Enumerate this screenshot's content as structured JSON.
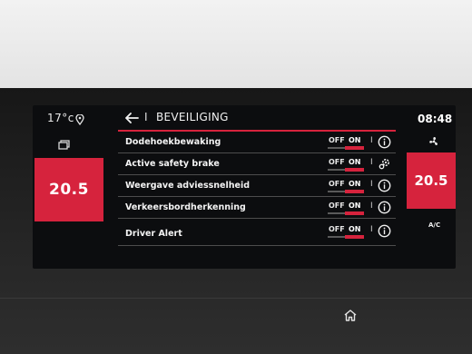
{
  "left_panel": {
    "outside_temp": "17°c",
    "location_icon": "location-pin-icon",
    "stack_icon": "screens-icon",
    "temp_setting": "20.5"
  },
  "right_panel": {
    "clock": "08:48",
    "fan_icon": "fan-icon",
    "temp_setting": "20.5",
    "ac_label": "A/C"
  },
  "header": {
    "back_icon": "arrow-left-icon",
    "separator": "I",
    "title": "BEVEILIGING"
  },
  "rows": [
    {
      "label": "Dodehoekbewaking",
      "off": "OFF",
      "on": "ON",
      "state": "ON",
      "action_icon": "info-icon"
    },
    {
      "label": "Active safety brake",
      "off": "OFF",
      "on": "ON",
      "state": "ON",
      "action_icon": "settings-icon"
    },
    {
      "label": "Weergave adviessnelheid",
      "off": "OFF",
      "on": "ON",
      "state": "ON",
      "action_icon": "info-icon"
    },
    {
      "label": "Verkeersbordherkenning",
      "off": "OFF",
      "on": "ON",
      "state": "ON",
      "action_icon": "info-icon"
    },
    {
      "label": "Driver Alert",
      "off": "OFF",
      "on": "ON",
      "state": "ON",
      "action_icon": "info-icon"
    }
  ],
  "row_separator": "I",
  "colors": {
    "accent": "#d6233d",
    "screen_bg": "#0c0d0f",
    "text": "#f4f4f4"
  },
  "home_icon": "home-icon"
}
